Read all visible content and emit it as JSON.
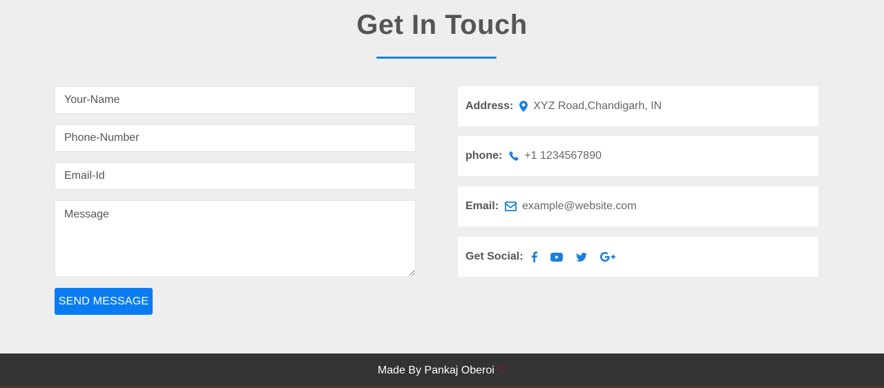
{
  "page": {
    "title": "Get In Touch"
  },
  "form": {
    "name_placeholder": "Your-Name",
    "phone_placeholder": "Phone-Number",
    "email_placeholder": "Email-Id",
    "message_placeholder": "Message",
    "send_label": "SEND MESSAGE"
  },
  "contact": {
    "address_label": "Address:",
    "address_value": "XYZ Road,Chandigarh, IN",
    "phone_label": "phone:",
    "phone_value": "+1 1234567890",
    "email_label": "Email:",
    "email_value": "example@website.com",
    "social_label": "Get Social:"
  },
  "footer": {
    "text": "Made By Pankaj Oberoi",
    "heart": "♡"
  },
  "colors": {
    "accent": "#0a7cf2",
    "background": "#eeeeee",
    "footer_bg": "#333333",
    "heart": "#e0202a"
  }
}
